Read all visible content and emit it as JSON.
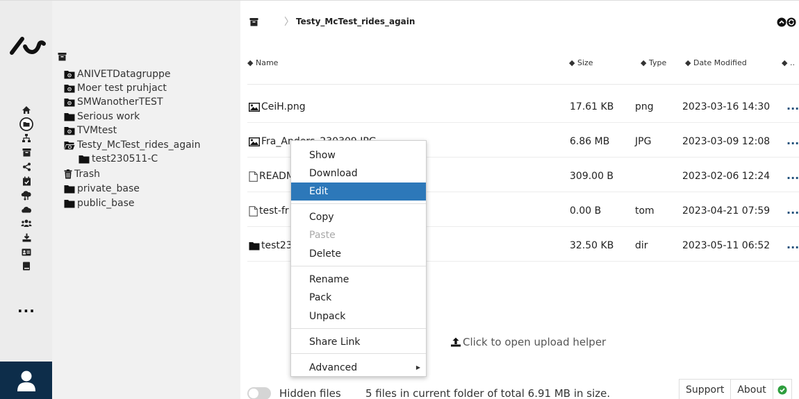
{
  "breadcrumb": {
    "current": "Testy_McTest_rides_again"
  },
  "tree": {
    "items": [
      {
        "label": "ANIVETDatagruppe",
        "icon": "shared-folder-icon"
      },
      {
        "label": "Moer test pruhjact",
        "icon": "shared-folder-icon"
      },
      {
        "label": "SMWanotherTEST",
        "icon": "shared-folder-icon"
      },
      {
        "label": "Serious work",
        "icon": "folder-icon"
      },
      {
        "label": "TVMtest",
        "icon": "shared-folder-icon"
      },
      {
        "label": "Testy_McTest_rides_again",
        "icon": "shared-folder-open-icon"
      },
      {
        "label": "test230511-C",
        "icon": "folder-icon"
      },
      {
        "label": "Trash",
        "icon": "trash-icon"
      },
      {
        "label": "private_base",
        "icon": "folder-icon"
      },
      {
        "label": "public_base",
        "icon": "folder-icon"
      }
    ]
  },
  "table": {
    "headers": {
      "name": "Name",
      "size": "Size",
      "type": "Type",
      "date": "Date Modified",
      "more": ".."
    },
    "rows": [
      {
        "name": "CeiH.png",
        "size": "17.61 KB",
        "type": "png",
        "date": "2023-03-16 14:30",
        "icon": "image-icon"
      },
      {
        "name": "Fra_Anders_230309.JPG",
        "size": "6.86 MB",
        "type": "JPG",
        "date": "2023-03-09 12:08",
        "icon": "image-icon"
      },
      {
        "name": "READM",
        "size": "309.00 B",
        "type": "",
        "date": "2023-02-06 12:24",
        "icon": "file-icon"
      },
      {
        "name": "test-fr",
        "size": "0.00 B",
        "type": "tom",
        "date": "2023-04-21 07:59",
        "icon": "file-icon"
      },
      {
        "name": "test23",
        "size": "32.50 KB",
        "type": "dir",
        "date": "2023-05-11 06:52",
        "icon": "folder-icon"
      }
    ],
    "row_more": "..."
  },
  "upload": {
    "label": "Click to open upload helper"
  },
  "footer": {
    "hidden_files": "Hidden files",
    "status": "5 files in current folder of total 6.91 MB in size.",
    "support": "Support",
    "about": "About"
  },
  "rail": {
    "more": "..."
  },
  "context_menu": {
    "items": [
      {
        "label": "Show"
      },
      {
        "label": "Download"
      },
      {
        "label": "Edit",
        "active": true
      },
      {
        "label": "Copy"
      },
      {
        "label": "Paste",
        "disabled": true
      },
      {
        "label": "Delete"
      },
      {
        "label": "Rename"
      },
      {
        "label": "Pack"
      },
      {
        "label": "Unpack"
      },
      {
        "label": "Share Link"
      },
      {
        "label": "Advanced",
        "submenu": true
      }
    ]
  },
  "colors": {
    "accent": "#2d78b9",
    "navy": "#0d2d4a",
    "ok_green": "#2e9e3e",
    "link_blue": "#1f4f7a"
  }
}
